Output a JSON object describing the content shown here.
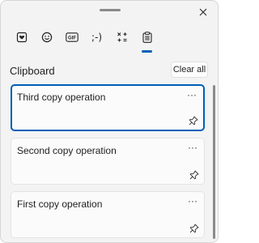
{
  "header": {
    "tabs": [
      {
        "name": "sticker-icon",
        "glyph": ""
      },
      {
        "name": "emoji-icon",
        "glyph": ""
      },
      {
        "name": "gif-icon",
        "glyph": "GIF"
      },
      {
        "name": "kaomoji-icon",
        "glyph": ";-)"
      },
      {
        "name": "symbols-icon",
        "glyph": ""
      },
      {
        "name": "clipboard-icon",
        "glyph": "",
        "active": true
      }
    ]
  },
  "section": {
    "title": "Clipboard",
    "clear_label": "Clear all"
  },
  "items": [
    {
      "text": "Third copy operation",
      "selected": true
    },
    {
      "text": "Second copy operation",
      "selected": false
    },
    {
      "text": "First copy operation",
      "selected": false
    }
  ],
  "colors": {
    "accent": "#005fb8",
    "panel_bg": "#f3f3f3"
  }
}
